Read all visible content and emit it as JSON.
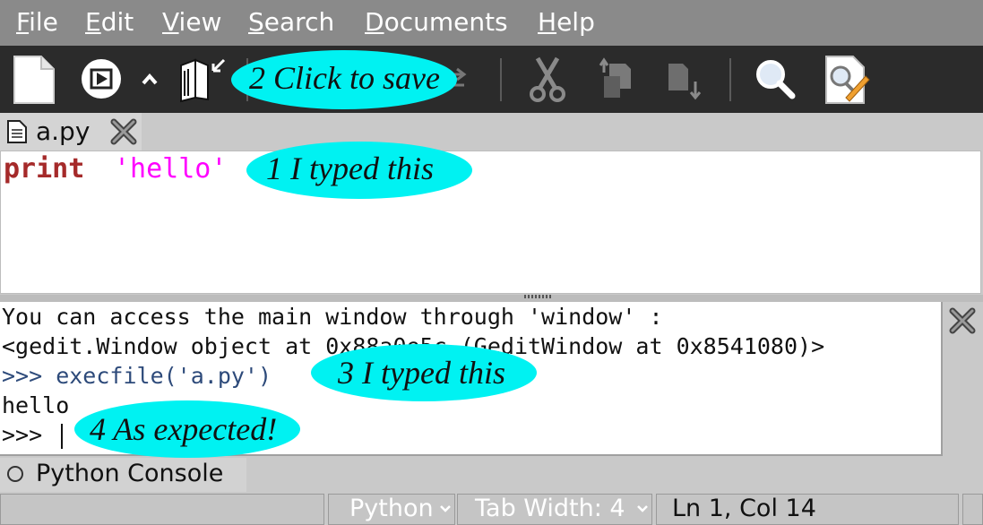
{
  "menubar": {
    "items": [
      {
        "underline": "F",
        "rest": "ile"
      },
      {
        "underline": "E",
        "rest": "dit"
      },
      {
        "underline": "V",
        "rest": "iew"
      },
      {
        "underline": "S",
        "rest": "earch"
      },
      {
        "underline": "D",
        "rest": "ocuments"
      },
      {
        "underline": "H",
        "rest": "elp"
      }
    ]
  },
  "toolbar": {
    "icons": [
      "new-document-icon",
      "run-icon",
      "up-arrow-icon",
      "save-book-icon",
      "cut-icon",
      "copy-icon",
      "paste-icon",
      "find-icon",
      "find-replace-icon"
    ]
  },
  "tab": {
    "filename": "a.py"
  },
  "editor": {
    "keyword": "print",
    "string": "'hello'"
  },
  "console": {
    "lines": [
      "You can access the main window through 'window' :",
      "<gedit.Window object at 0x88a0e5c (GeditWindow at 0x8541080)>",
      ">>> execfile('a.py')",
      "hello",
      ">>> "
    ]
  },
  "panel": {
    "label": "Python Console"
  },
  "statusbar": {
    "language": "Python",
    "tab_width": "Tab Width:  4",
    "position": "Ln 1, Col 14"
  },
  "annotations": {
    "a1": "1   I typed this",
    "a2": "2  Click to save",
    "a3": "3  I typed this",
    "a4": "4  As expected!"
  },
  "colors": {
    "keyword": "#a52a2a",
    "string": "#ff00ff",
    "prompt": "#2d4a7a",
    "annotation": "#00f2f2"
  }
}
